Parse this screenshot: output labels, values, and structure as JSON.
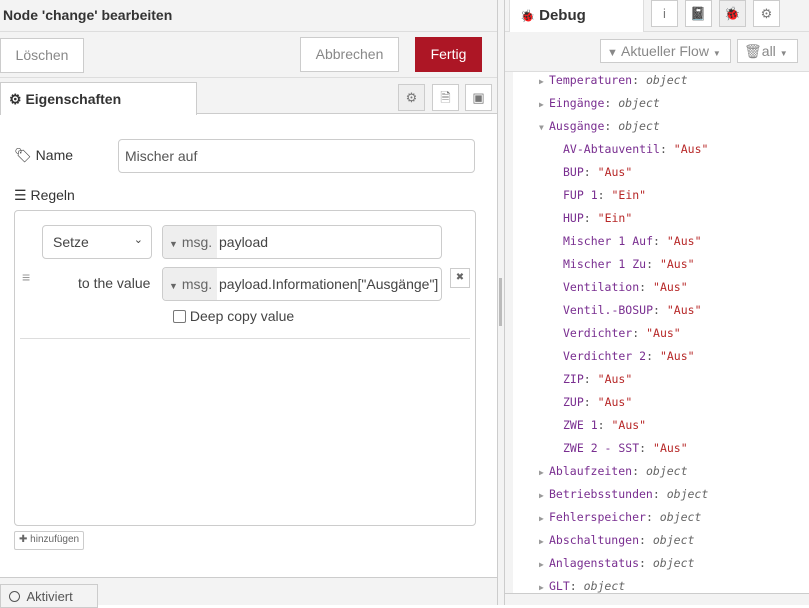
{
  "editor": {
    "title": "Node 'change' bearbeiten",
    "delete_label": "Löschen",
    "cancel_label": "Abbrechen",
    "done_label": "Fertig",
    "done_color": "#ad1625",
    "tab_label": "Eigenschaften",
    "name_label": "Name",
    "name_value": "Mischer auf",
    "rules_label": "Regeln",
    "rule": {
      "action": "Setze",
      "target_type": "msg.",
      "target_value": "payload",
      "to_label": "to the value",
      "value_type": "msg.",
      "value": "payload.Informationen[\"Ausgänge\"]",
      "deep_copy_label": "Deep copy value"
    },
    "add_label": "hinzufügen",
    "enabled_label": "Aktiviert"
  },
  "sidebar": {
    "tab_label": "Debug",
    "filter_label": "Aktueller Flow",
    "clear_label": "all",
    "messages": [
      {
        "key": "Temperaturen",
        "value": "object",
        "type": "object",
        "indent": 0,
        "expanded": false
      },
      {
        "key": "Eingänge",
        "value": "object",
        "type": "object",
        "indent": 0,
        "expanded": false
      },
      {
        "key": "Ausgänge",
        "value": "object",
        "type": "object",
        "indent": 0,
        "expanded": true
      },
      {
        "key": "AV-Abtauventil",
        "value": "\"Aus\"",
        "type": "string",
        "indent": 1
      },
      {
        "key": "BUP",
        "value": "\"Aus\"",
        "type": "string",
        "indent": 1
      },
      {
        "key": "FUP 1",
        "value": "\"Ein\"",
        "type": "string",
        "indent": 1
      },
      {
        "key": "HUP",
        "value": "\"Ein\"",
        "type": "string",
        "indent": 1
      },
      {
        "key": "Mischer 1 Auf",
        "value": "\"Aus\"",
        "type": "string",
        "indent": 1
      },
      {
        "key": "Mischer 1 Zu",
        "value": "\"Aus\"",
        "type": "string",
        "indent": 1
      },
      {
        "key": "Ventilation",
        "value": "\"Aus\"",
        "type": "string",
        "indent": 1
      },
      {
        "key": "Ventil.-BOSUP",
        "value": "\"Aus\"",
        "type": "string",
        "indent": 1
      },
      {
        "key": "Verdichter",
        "value": "\"Aus\"",
        "type": "string",
        "indent": 1
      },
      {
        "key": "Verdichter 2",
        "value": "\"Aus\"",
        "type": "string",
        "indent": 1
      },
      {
        "key": "ZIP",
        "value": "\"Aus\"",
        "type": "string",
        "indent": 1
      },
      {
        "key": "ZUP",
        "value": "\"Aus\"",
        "type": "string",
        "indent": 1
      },
      {
        "key": "ZWE 1",
        "value": "\"Aus\"",
        "type": "string",
        "indent": 1
      },
      {
        "key": "ZWE 2 - SST",
        "value": "\"Aus\"",
        "type": "string",
        "indent": 1
      },
      {
        "key": "Ablaufzeiten",
        "value": "object",
        "type": "object",
        "indent": 0,
        "expanded": false
      },
      {
        "key": "Betriebsstunden",
        "value": "object",
        "type": "object",
        "indent": 0,
        "expanded": false
      },
      {
        "key": "Fehlerspeicher",
        "value": "object",
        "type": "object",
        "indent": 0,
        "expanded": false
      },
      {
        "key": "Abschaltungen",
        "value": "object",
        "type": "object",
        "indent": 0,
        "expanded": false
      },
      {
        "key": "Anlagenstatus",
        "value": "object",
        "type": "object",
        "indent": 0,
        "expanded": false
      },
      {
        "key": "GLT",
        "value": "object",
        "type": "object",
        "indent": 0,
        "expanded": false
      }
    ]
  }
}
